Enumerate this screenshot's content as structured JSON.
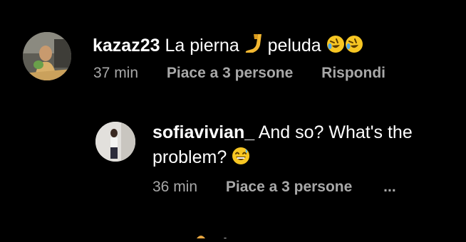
{
  "comment": {
    "username": "kazaz23",
    "text_before": "La pierna",
    "text_after": "peluda",
    "time": "37 min",
    "likes": "Piace a 3 persone",
    "reply_label": "Rispondi",
    "emojis": [
      "leg-emoji",
      "rofl-emoji",
      "rofl-emoji"
    ]
  },
  "reply": {
    "username": "sofiavivian_",
    "text_line1": "And so? What's the",
    "text_line2": "problem?",
    "time": "36 min",
    "likes": "Piace a 3 persone",
    "more_label": "...",
    "emojis": [
      "sweat-smile-emoji"
    ]
  },
  "colors": {
    "background": "#000000",
    "text": "#ffffff",
    "meta": "#a8a8a8",
    "emoji_yellow": "#f7c623"
  }
}
